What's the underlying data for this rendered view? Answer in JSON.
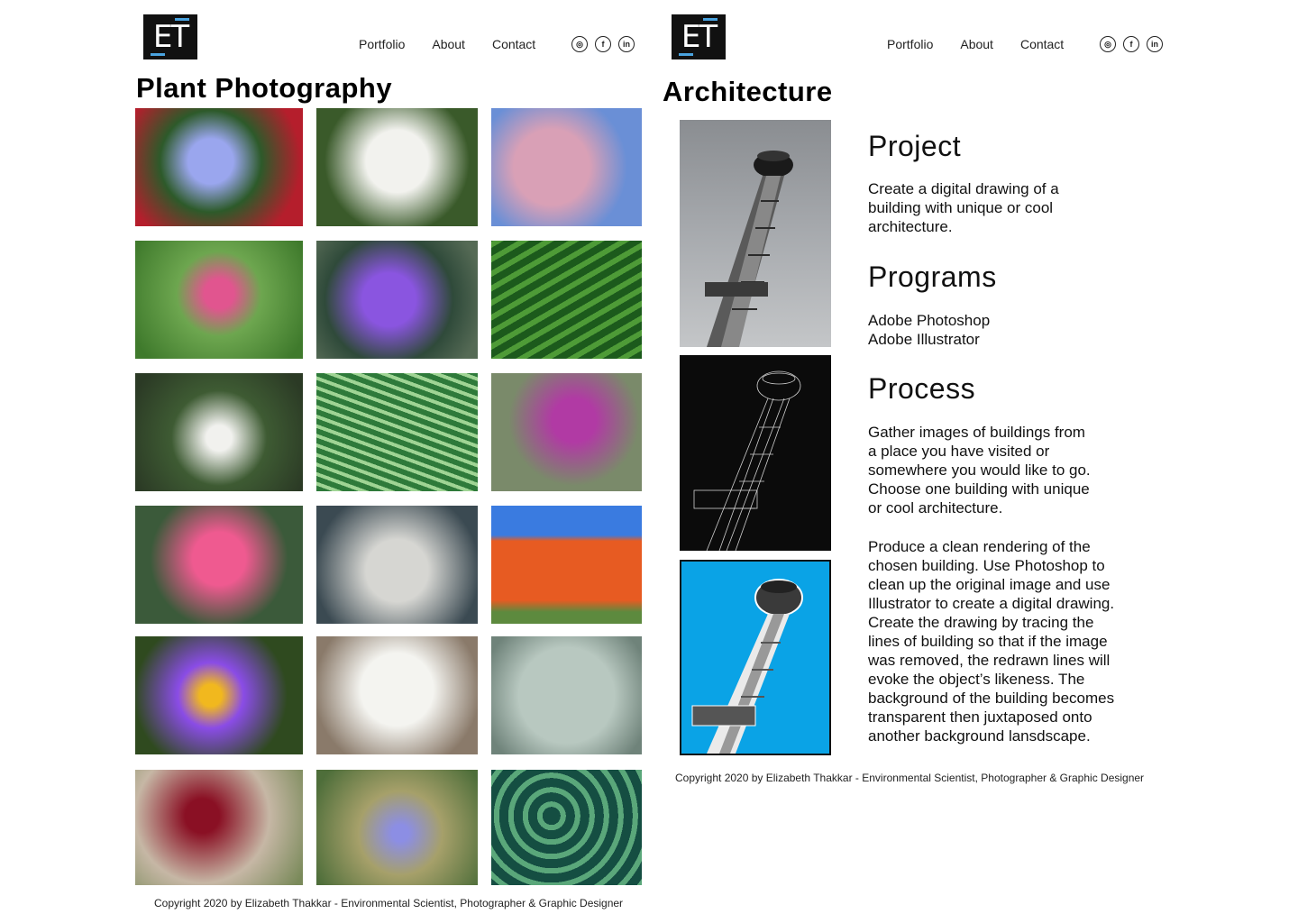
{
  "logo": {
    "text": "ET"
  },
  "nav": {
    "portfolio": "Portfolio",
    "about": "About",
    "contact": "Contact"
  },
  "social": {
    "instagram": "◎",
    "facebook": "f",
    "linkedin": "in"
  },
  "left": {
    "title": "Plant Photography",
    "footer": "Copyright 2020 by Elizabeth Thakkar - Environmental Scientist, Photographer & Graphic Designer",
    "photos": [
      "blue-plumbago-flowers",
      "white-lilies",
      "pink-cherry-blossoms",
      "pink-lotus",
      "purple-water-lily",
      "palm-fronds",
      "white-spider-lily",
      "fan-palm-leaf",
      "purple-loosestrife",
      "pink-water-lilies",
      "fuzzy-cactus",
      "orange-aloe-flowers",
      "purple-lotus",
      "white-queen-annes-lace",
      "agave-leaves",
      "red-geranium",
      "blue-chicory",
      "calathea-leaves"
    ]
  },
  "right": {
    "title": "Architecture",
    "footer": "Copyright 2020 by Elizabeth Thakkar - Environmental Scientist, Photographer & Graphic Designer",
    "project_heading": "Project",
    "project_text": "Create a digital drawing of a\nbuilding with unique or cool\narchitecture.",
    "programs_heading": "Programs",
    "programs_text": "Adobe Photoshop\nAdobe Illustrator",
    "process_heading": "Process",
    "process_text_1": "Gather images of buildings from\na place you have visited or\nsomewhere you would like to go.\nChoose one building with unique\nor cool architecture.",
    "process_text_2": "Produce a clean rendering of the\nchosen building. Use Photoshop to\nclean up the original image and use\nIllustrator to create a digital drawing.\nCreate the drawing by tracing the\nlines of building so that if the image\nwas removed, the redrawn lines will\nevoke the object’s likeness. The\nbackground of the building becomes\ntransparent then juxtaposed onto\nanother background lansdscape."
  },
  "colors": {
    "accent_blue": "#0aa3e6",
    "logo_bg": "#111111",
    "logo_bar": "#4aa3df"
  }
}
